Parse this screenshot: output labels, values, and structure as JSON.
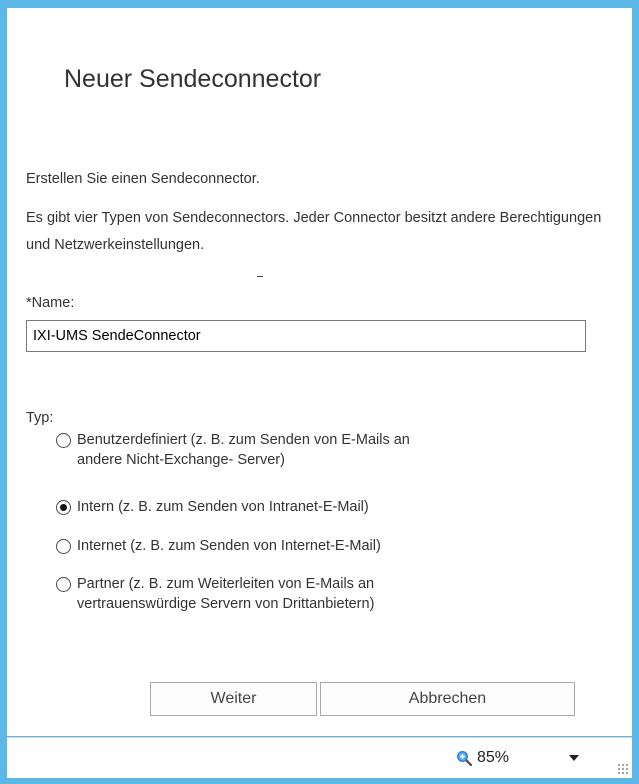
{
  "dialog": {
    "title": "Neuer Sendeconnector",
    "intro": "Erstellen Sie einen Sendeconnector.",
    "description": "Es gibt vier Typen von Sendeconnectors. Jeder Connector besitzt andere Berechtigungen und Netzwerkeinstellungen.",
    "name_label": "*Name:",
    "name_value": "IXI-UMS SendeConnector",
    "type_label": "Typ:",
    "options": [
      {
        "line1": "Benutzerdefiniert (z. B. zum Senden von E-Mails an",
        "line2": "andere Nicht-Exchange- Server)",
        "checked": false
      },
      {
        "line1": "Intern (z. B. zum Senden von Intranet-E-Mail)",
        "line2": "",
        "checked": true
      },
      {
        "line1": "Internet (z. B. zum Senden von Internet-E-Mail)",
        "line2": "",
        "checked": false
      },
      {
        "line1": "Partner (z. B. zum Weiterleiten von E-Mails an",
        "line2": "vertrauenswürdige Servern von Drittanbietern)",
        "checked": false
      }
    ],
    "next_label": "Weiter",
    "cancel_label": "Abbrechen"
  },
  "statusbar": {
    "zoom": "85%",
    "zoom_icon": "zoom-in-icon",
    "dropdown_icon": "chevron-down-icon"
  },
  "colors": {
    "window_border": "#5cb8e6",
    "text": "#333333",
    "zoom_icon": "#2f7fd0"
  }
}
